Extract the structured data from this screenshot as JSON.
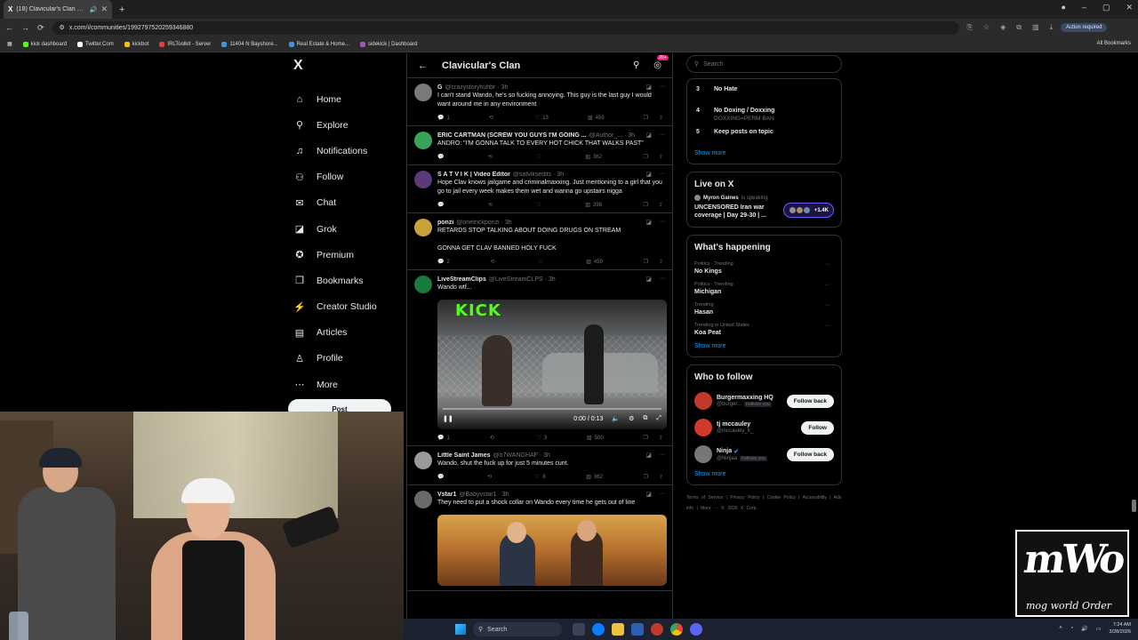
{
  "browser": {
    "tab_title": "(18) Clavicular's Clan Comm",
    "tab_favicon": "X",
    "url": "x.com/i/communities/1992797520259346880",
    "action_required": "Action required",
    "bookmarks": [
      {
        "label": "kick dashboard",
        "color": "#53fc18"
      },
      {
        "label": "Twitter.Com",
        "color": "#ffffff"
      },
      {
        "label": "kickbot",
        "color": "#f5c400"
      },
      {
        "label": "IRLToolkit - Server",
        "color": "#e04040"
      },
      {
        "label": "11404 N Bayshore...",
        "color": "#4a90e2"
      },
      {
        "label": "Real Estate & Home...",
        "color": "#4a90e2"
      },
      {
        "label": "sidekick | Dashboard",
        "color": "#9b59b6"
      }
    ],
    "all_bookmarks": "All Bookmarks"
  },
  "nav": {
    "logo": "X",
    "items": [
      {
        "label": "Home",
        "icon": "home-icon",
        "glyph": "⌂"
      },
      {
        "label": "Explore",
        "icon": "search-icon",
        "glyph": "⚲"
      },
      {
        "label": "Notifications",
        "icon": "bell-icon",
        "glyph": "♫"
      },
      {
        "label": "Follow",
        "icon": "person-icon",
        "glyph": "⚇"
      },
      {
        "label": "Chat",
        "icon": "mail-icon",
        "glyph": "✉"
      },
      {
        "label": "Grok",
        "icon": "grok-icon",
        "glyph": "◪"
      },
      {
        "label": "Premium",
        "icon": "premium-icon",
        "glyph": "✪"
      },
      {
        "label": "Bookmarks",
        "icon": "bookmark-icon",
        "glyph": "❒"
      },
      {
        "label": "Creator Studio",
        "icon": "lightning-icon",
        "glyph": "⚡"
      },
      {
        "label": "Articles",
        "icon": "articles-icon",
        "glyph": "▤"
      },
      {
        "label": "Profile",
        "icon": "profile-icon",
        "glyph": "♙"
      },
      {
        "label": "More",
        "icon": "more-circle-icon",
        "glyph": "⋯"
      }
    ],
    "post": "Post"
  },
  "feed": {
    "title": "Clavicular's Clan",
    "badge": "20+",
    "tweets": [
      {
        "name": "G",
        "handle": "@crazystoryhuhbr · 3h",
        "text": "I can't stand Wando, he's so fucking  annoying. This guy is the last guy I would want around me in any environment",
        "replies": "1",
        "reposts": "",
        "likes": "13",
        "views": "459",
        "avatar": "#7a7a7a",
        "media": ""
      },
      {
        "name": "ERIC CARTMAN (SCREW YOU GUYS I'M GOING ...",
        "handle": "@Author_... · 3h",
        "text": "ANDRO: \"I'M GONNA TALK TO EVERY HOT CHICK THAT WALKS PAST\"",
        "replies": "",
        "reposts": "",
        "likes": "",
        "views": "362",
        "avatar": "#3aa35a",
        "media": ""
      },
      {
        "name": "S A T V I K | Video Editor",
        "handle": "@satviksedits · 3h",
        "text": "Hope Clav knows jailgame and criminalmaxxing. Just mentioning to a girl that you go to jail every week makes them wet and wanna go upstairs nigga",
        "replies": "",
        "reposts": "",
        "likes": "",
        "views": "398",
        "avatar": "#5b3a7a",
        "media": ""
      },
      {
        "name": "ponzi",
        "handle": "@onetrickponzi · 3h",
        "text": "RETARDS STOP TALKING ABOUT DOING DRUGS ON STREAM\n\nGONNA GET CLAV BANNED HOLY FUCK",
        "replies": "2",
        "reposts": "",
        "likes": "",
        "views": "459",
        "avatar": "#c9a23a",
        "media": ""
      },
      {
        "name": "LiveStreamClips",
        "handle": "@LiveStreamCLPS · 3h",
        "text": "Wando wtf...",
        "replies": "1",
        "reposts": "",
        "likes": "3",
        "views": "500",
        "avatar": "#1a7a3a",
        "media": "video"
      },
      {
        "name": "Little Saint James",
        "handle": "@o7WANGHAF · 3h",
        "text": "Wando, shut the fuck up for just 5 minutes cunt.",
        "replies": "",
        "reposts": "",
        "likes": "8",
        "views": "362",
        "avatar": "#9a9a9a",
        "media": ""
      },
      {
        "name": "Vstar1",
        "handle": "@Babyvstar1 · 3h",
        "text": "They need to put a shock collar on Wando every time he gets out of line",
        "replies": "",
        "reposts": "",
        "likes": "",
        "views": "",
        "avatar": "#6a6a6a",
        "media": "image"
      }
    ],
    "video": {
      "brand": "KICK",
      "time": "0:00 / 0:13"
    }
  },
  "right": {
    "search_placeholder": "Search",
    "rules": [
      {
        "num": "3",
        "title": "No Hate",
        "sub": ""
      },
      {
        "num": "4",
        "title": "No Doxing / Doxxing",
        "sub": "DOXXING=PERM BAN"
      },
      {
        "num": "5",
        "title": "Keep posts on topic",
        "sub": ""
      }
    ],
    "show_more": "Show more",
    "live": {
      "title": "Live on X",
      "host": "Myron Gaines",
      "status": "is speaking",
      "desc": "UNCENSORED Iran war coverage | Day 29-30 | ...",
      "count": "+1.4K"
    },
    "happening": {
      "title": "What's happening",
      "trends": [
        {
          "cat": "Politics · Trending",
          "name": "No Kings"
        },
        {
          "cat": "Politics · Trending",
          "name": "Michigan"
        },
        {
          "cat": "Trending",
          "name": "Hasan"
        },
        {
          "cat": "Trending in United States",
          "name": "Koa Peat"
        }
      ]
    },
    "who": {
      "title": "Who to follow",
      "people": [
        {
          "name": "Burgermaxxing HQ",
          "handle": "@burger...",
          "follows_you": "Follows you",
          "button": "Follow back",
          "verified": false,
          "avatar": "#c0392b"
        },
        {
          "name": "tj mccauley",
          "handle": "@mccauley_lr_",
          "follows_you": "",
          "button": "Follow",
          "verified": false,
          "avatar": "#d0392b"
        },
        {
          "name": "Ninja",
          "handle": "@Ninjaa",
          "follows_you": "Follows you",
          "button": "Follow back",
          "verified": true,
          "avatar": "#777777"
        }
      ]
    },
    "footer": "Terms of Service  |  Privacy Policy  |  Cookie Policy  |  Accessibility  |  Ads info  |  More ···  © 2026 X Corp."
  },
  "overlay": {
    "logo_big": "mWo",
    "logo_sub": "mog world Order"
  },
  "taskbar": {
    "search": "Search",
    "time": "7:24 AM",
    "date": "3/28/2026"
  }
}
